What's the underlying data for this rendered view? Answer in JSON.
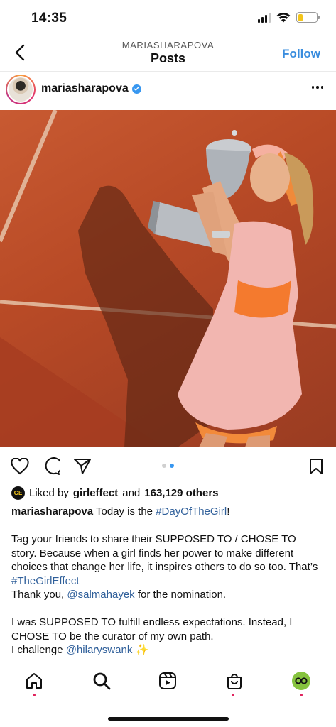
{
  "status_bar": {
    "time": "14:35",
    "battery_level": 0.25,
    "battery_color": "#f3c51b"
  },
  "header": {
    "subtitle": "MARIASHARAPOVA",
    "title": "Posts",
    "follow_label": "Follow",
    "back_icon": "chevron-left-icon"
  },
  "post": {
    "username": "mariasharapova",
    "verified": true,
    "image_description_icon": "photo",
    "carousel": {
      "total": 2,
      "current": 2
    },
    "likes": {
      "prefix": "Liked by",
      "liker": "girleffect",
      "liker_avatar_text": "GE",
      "and_text": "and",
      "others": "163,129 others"
    },
    "caption": {
      "username": "mariasharapova",
      "line1_text": " Today is the ",
      "line1_tag": "#DayOfTheGirl",
      "line1_end": "!",
      "para2": "Tag your friends to share their SUPPOSED TO / CHOSE TO story. Because when a girl finds her power to make different choices that change her life, it inspires others to do so too. That’s ",
      "para2_tag": "#TheGirlEffect",
      "thanks_prefix": "Thank you, ",
      "thanks_mention": "@salmahayek",
      "thanks_suffix": " for the nomination.",
      "para3": "I was SUPPOSED TO fulfill endless expectations. Instead, I CHOSE TO be the curator of my own path.",
      "challenge_prefix": "I challenge ",
      "challenge_mention": "@hilaryswank",
      "challenge_emoji": "✨"
    }
  },
  "tabbar": {
    "items": [
      "home",
      "search",
      "reels",
      "shop",
      "profile"
    ],
    "profile_color": "#86c33e"
  },
  "colors": {
    "accent": "#3a8dde",
    "tag": "#2f5f9a",
    "notification": "#e0245e"
  }
}
